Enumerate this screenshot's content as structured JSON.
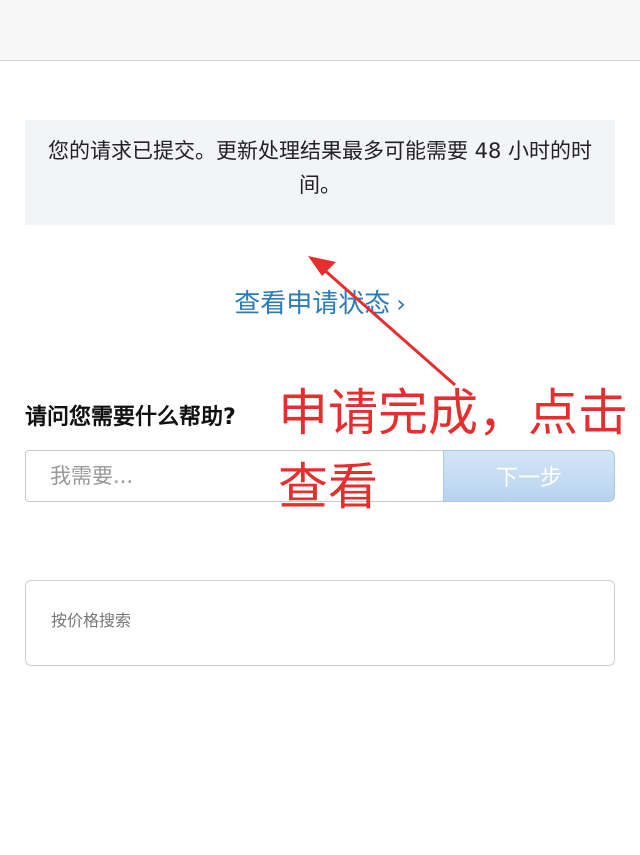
{
  "notice": {
    "message": "您的请求已提交。更新处理结果最多可能需要 48 小时的时间。"
  },
  "status_link": {
    "label": "查看申请状态",
    "chevron": "›"
  },
  "help": {
    "label": "请问您需要什么帮助?",
    "input_placeholder": "我需要...",
    "next_label": "下一步"
  },
  "price_search": {
    "placeholder": "按价格搜索"
  },
  "annotation": {
    "text": "申请完成，点击查看",
    "color": "#e62e2e"
  },
  "colors": {
    "link": "#2b7bb9",
    "notice_bg": "#f3f4f8"
  }
}
